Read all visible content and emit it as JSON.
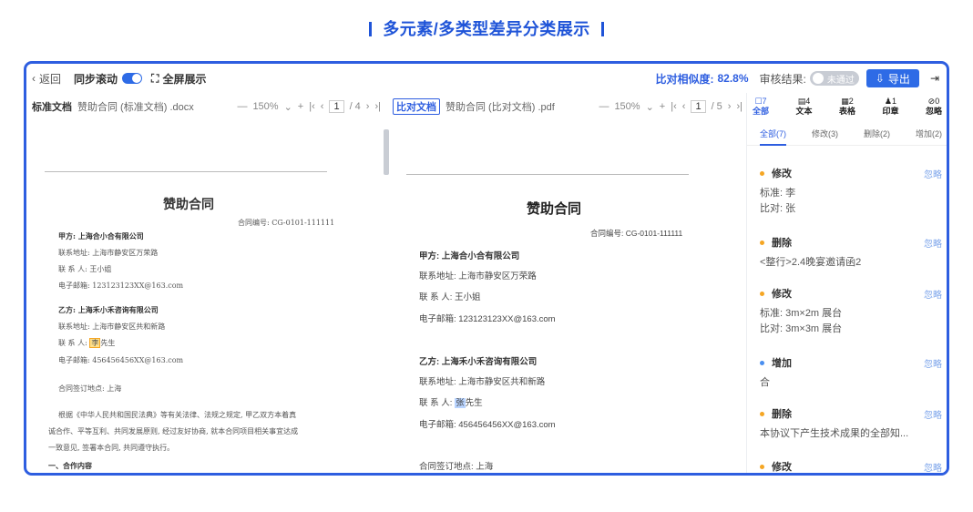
{
  "banner": {
    "title": "多元素/多类型差异分类展示"
  },
  "topbar": {
    "back_label": "返回",
    "sync_label": "同步滚动",
    "fullscreen_label": "全屏展示",
    "similarity_label": "比对相似度:",
    "similarity_value": "82.8%",
    "audit_label": "审核结果:",
    "audit_toggle_label": "未通过",
    "export_label": "导出"
  },
  "left_doc": {
    "tag": "标准文档",
    "filename": "赞助合同 (标准文档) .docx",
    "zoom": "150%",
    "page_current": "1",
    "page_total": "/ 4",
    "title": "赞助合同",
    "contract_no": "合同编号: CG-0101-111111",
    "lines": [
      "甲方: 上海合小合有限公司",
      "联系地址: 上海市静安区万荣路",
      "联 系 人: 王小姐",
      "电子邮箱: 123123123XX@163.com",
      "乙方: 上海禾小禾咨询有限公司",
      "联系地址: 上海市静安区共和新路",
      "联 系 人: ",
      "李",
      "先生",
      "电子邮箱: 456456456XX@163.com",
      "合同签订地点: 上海",
      "根据《中华人民共和国民法典》等有关法律、法规之规定, 甲乙双方本着真",
      "诚合作、平等互利、共同发展原则, 经过友好协商, 就本合同项目相关事宜达成",
      "一致意见, 签署本合同, 共同遵守执行。",
      "一、合作内容"
    ]
  },
  "right_doc": {
    "tag": "比对文档",
    "filename": "赞助合同 (比对文档) .pdf",
    "zoom": "150%",
    "page_current": "1",
    "page_total": "/ 5",
    "title": "赞助合同",
    "contract_no": "合同编号: CG-0101-111111",
    "lines": [
      "甲方: 上海合小合有限公司",
      "联系地址: 上海市静安区万荣路",
      "联 系 人: 王小姐",
      "电子邮箱: 123123123XX@163.com",
      "乙方: 上海禾小禾咨询有限公司",
      "联系地址: 上海市静安区共和新路",
      "联 系 人: ",
      "张",
      "先生",
      "电子邮箱: 456456456XX@163.com",
      "合同签订地点: 上海"
    ]
  },
  "panel": {
    "categories": [
      {
        "count": "7",
        "label": "全部",
        "icon": "all-icon"
      },
      {
        "count": "4",
        "label": "文本",
        "icon": "text-icon"
      },
      {
        "count": "2",
        "label": "表格",
        "icon": "table-icon"
      },
      {
        "count": "1",
        "label": "印章",
        "icon": "seal-icon"
      },
      {
        "count": "0",
        "label": "忽略",
        "icon": "ignore-icon"
      }
    ],
    "tabs": [
      "全部(7)",
      "修改(3)",
      "删除(2)",
      "增加(2)"
    ],
    "items": [
      {
        "type": "修改",
        "ignore": "忽略",
        "color": "#f5a623",
        "body": [
          "标准: 李",
          "比对: 张"
        ]
      },
      {
        "type": "删除",
        "ignore": "忽略",
        "color": "#f5a623",
        "body": [
          "<整行>2.4晚宴邀请函2"
        ]
      },
      {
        "type": "修改",
        "ignore": "忽略",
        "color": "#f5a623",
        "body": [
          "标准: 3m×2m 展台",
          "比对: 3m×3m 展台"
        ]
      },
      {
        "type": "增加",
        "ignore": "忽略",
        "color": "#4a8ff0",
        "body": [
          "合"
        ]
      },
      {
        "type": "删除",
        "ignore": "忽略",
        "color": "#f5a623",
        "body": [
          "本协议下产生技术成果的全部知..."
        ]
      },
      {
        "type": "修改",
        "ignore": "忽略",
        "color": "#f5a623",
        "body": []
      }
    ]
  }
}
